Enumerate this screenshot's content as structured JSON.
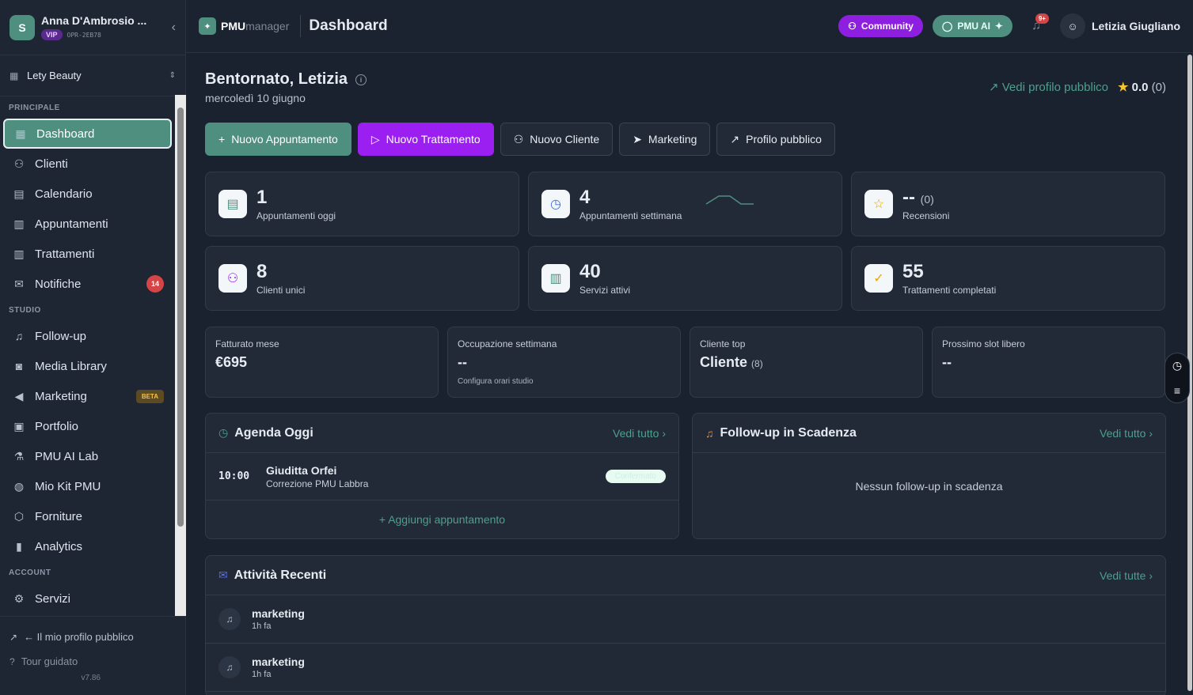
{
  "sidebar": {
    "avatar_letter": "S",
    "user_name": "Anna D'Ambrosio ...",
    "vip": "VIP",
    "code": "OPR-2EB78",
    "studio": "Lety Beauty",
    "sections": [
      {
        "title": "PRINCIPALE"
      },
      {
        "title": "STUDIO"
      },
      {
        "title": "ACCOUNT"
      }
    ],
    "items": [
      {
        "label": "Dashboard"
      },
      {
        "label": "Clienti"
      },
      {
        "label": "Calendario"
      },
      {
        "label": "Appuntamenti"
      },
      {
        "label": "Trattamenti"
      },
      {
        "label": "Notifiche",
        "badge": "14"
      },
      {
        "label": "Follow-up"
      },
      {
        "label": "Media Library"
      },
      {
        "label": "Marketing",
        "beta": "BETA"
      },
      {
        "label": "Portfolio"
      },
      {
        "label": "PMU AI Lab"
      },
      {
        "label": "Mio Kit PMU"
      },
      {
        "label": "Forniture"
      },
      {
        "label": "Analytics"
      },
      {
        "label": "Servizi"
      }
    ],
    "footer": {
      "public_profile": "← Il mio profilo pubblico",
      "tour": "Tour guidato",
      "version": "v7.86"
    }
  },
  "topbar": {
    "logo_bold": "PMU",
    "logo_light": "manager",
    "title": "Dashboard",
    "community": "Community",
    "pmu_ai": "PMU AI",
    "notif_badge": "9+",
    "user_name": "Letizia Giugliano"
  },
  "greeting": {
    "title": "Bentornato, Letizia",
    "date": "mercoledì 10 giugno",
    "public_link": "Vedi profilo pubblico",
    "rating": "0.0",
    "rating_count": "(0)"
  },
  "actions": [
    {
      "label": "Nuovo Appuntamento"
    },
    {
      "label": "Nuovo Trattamento"
    },
    {
      "label": "Nuovo Cliente"
    },
    {
      "label": "Marketing"
    },
    {
      "label": "Profilo pubblico"
    }
  ],
  "stats": [
    {
      "value": "1",
      "label": "Appuntamenti oggi"
    },
    {
      "value": "4",
      "label": "Appuntamenti settimana"
    },
    {
      "value": "--",
      "sub": "(0)",
      "label": "Recensioni"
    },
    {
      "value": "8",
      "label": "Clienti unici"
    },
    {
      "value": "40",
      "label": "Servizi attivi"
    },
    {
      "value": "55",
      "label": "Trattamenti completati"
    }
  ],
  "kpis": [
    {
      "label": "Fatturato mese",
      "value": "€695"
    },
    {
      "label": "Occupazione settimana",
      "value": "--",
      "note": "Configura orari studio"
    },
    {
      "label": "Cliente top",
      "value": "Cliente",
      "sub": "(8)"
    },
    {
      "label": "Prossimo slot libero",
      "value": "--"
    }
  ],
  "agenda": {
    "title": "Agenda Oggi",
    "more": "Vedi tutto",
    "rows": [
      {
        "time": "10:00",
        "client": "Giuditta Orfei",
        "service": "Correzione PMU Labbra",
        "status": "Confermato"
      }
    ],
    "add": "Aggiungi appuntamento"
  },
  "followup": {
    "title": "Follow-up in Scadenza",
    "more": "Vedi tutto",
    "empty": "Nessun follow-up in scadenza"
  },
  "activity": {
    "title": "Attività Recenti",
    "more": "Vedi tutte",
    "rows": [
      {
        "title": "marketing",
        "time": "1h fa"
      },
      {
        "title": "marketing",
        "time": "1h fa"
      }
    ]
  },
  "colors": {
    "accent_teal": "#4e8f80",
    "accent_purple": "#9b1ff0",
    "badge_red": "#d64545",
    "background": "#1a2230"
  }
}
